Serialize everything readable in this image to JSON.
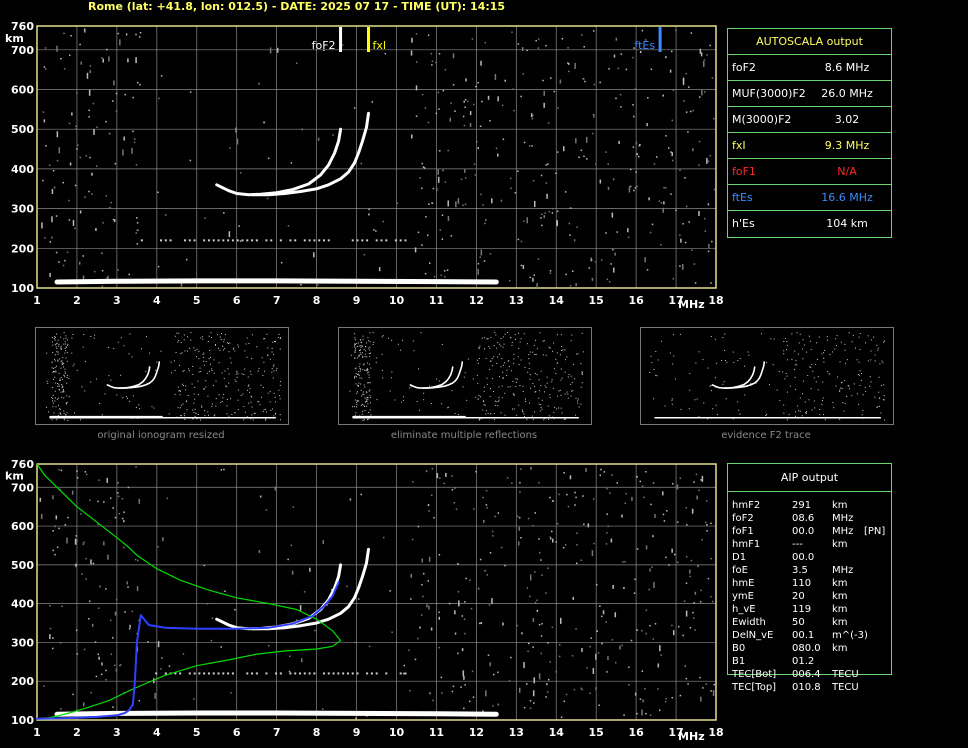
{
  "header": {
    "text": "Rome (lat: +41.8, lon: 012.5) - DATE: 2025 07 17 - TIME (UT): 14:15"
  },
  "colors": {
    "grid": "#8a8a8a",
    "frame": "#e6e08a",
    "panel_border": "#6cd76c",
    "title": "#ffff66",
    "fof2": "#ffffff",
    "fxi": "#ffff00",
    "fof1": "#ff2a2a",
    "ftes": "#3c8cff",
    "profile": "#00dd00",
    "trace_fit": "#3040ff"
  },
  "chart_data": [
    {
      "type": "scatter",
      "panel": "autoscala ionogram",
      "ylabel": "km",
      "xlabel": "MHz",
      "xlim": [
        1,
        18
      ],
      "ylim": [
        100,
        760
      ],
      "x_ticks": [
        "1",
        "2",
        "3",
        "4",
        "5",
        "6",
        "7",
        "8",
        "9",
        "10",
        "11",
        "12",
        "13",
        "14",
        "15",
        "16",
        "17",
        "18"
      ],
      "y_ticks": [
        "100",
        "200",
        "300",
        "400",
        "500",
        "600",
        "700",
        "760"
      ],
      "grid": true,
      "markers": [
        {
          "label": "foF2",
          "x": 8.6,
          "color": "#ffffff"
        },
        {
          "label": "fxI",
          "x": 9.3,
          "color": "#ffff00"
        },
        {
          "label": "ftEs",
          "x": 16.6,
          "color": "#3c8cff"
        }
      ],
      "traces": [
        {
          "name": "",
          "x": [
            5.5,
            5.8,
            6.0,
            6.3,
            6.6,
            7.0,
            7.4,
            7.8,
            8.1,
            8.3,
            8.45,
            8.55,
            8.6
          ],
          "y": [
            360,
            345,
            338,
            335,
            336,
            340,
            348,
            362,
            385,
            410,
            440,
            470,
            500
          ]
        },
        {
          "name": "",
          "x": [
            6.4,
            6.8,
            7.2,
            7.6,
            8.0,
            8.3,
            8.6,
            8.8,
            8.95,
            9.05,
            9.15,
            9.25,
            9.3
          ],
          "y": [
            335,
            335,
            338,
            343,
            350,
            360,
            375,
            392,
            415,
            440,
            470,
            505,
            540
          ]
        },
        {
          "name": "",
          "x": [
            1.5,
            3,
            5,
            7,
            9,
            11,
            12.5
          ],
          "y": [
            115,
            117,
            118,
            118,
            117,
            116,
            115
          ]
        }
      ]
    },
    {
      "type": "line",
      "panel": "AIP ionogram",
      "ylabel": "km",
      "xlabel": "MHz",
      "xlim": [
        1,
        18
      ],
      "ylim": [
        100,
        760
      ],
      "x_ticks": [
        "1",
        "2",
        "3",
        "4",
        "5",
        "6",
        "7",
        "8",
        "9",
        "10",
        "11",
        "12",
        "13",
        "14",
        "15",
        "16",
        "17",
        "18"
      ],
      "y_ticks": [
        "100",
        "200",
        "300",
        "400",
        "500",
        "600",
        "700",
        "760"
      ],
      "grid": true,
      "series": [
        {
          "name": "",
          "color": "#00dd00",
          "x": [
            1.0,
            1.2,
            1.6,
            2.0,
            2.5,
            3.0,
            3.3,
            3.5,
            4.0,
            4.6,
            5.3,
            6.0,
            6.8,
            7.5,
            8.0,
            8.4,
            8.6,
            8.4,
            8.0,
            7.2,
            6.5,
            5.8,
            5.0,
            4.2,
            3.4,
            2.8,
            2.2,
            1.8,
            1.5,
            1.3,
            1.1
          ],
          "y": [
            760,
            730,
            690,
            650,
            610,
            570,
            545,
            525,
            490,
            460,
            435,
            415,
            400,
            385,
            360,
            330,
            305,
            290,
            283,
            278,
            270,
            255,
            240,
            215,
            180,
            150,
            130,
            118,
            110,
            106,
            104
          ]
        },
        {
          "name": "",
          "color": "#3040ff",
          "x": [
            1.0,
            1.5,
            2.0,
            2.5,
            3.0,
            3.2,
            3.3,
            3.4,
            3.45,
            3.5,
            3.6,
            3.8,
            4.2,
            5.0,
            6.0,
            6.8,
            7.4,
            7.9,
            8.2,
            8.4,
            8.55
          ],
          "y": [
            103,
            104,
            106,
            108,
            112,
            118,
            125,
            140,
            200,
            300,
            370,
            345,
            338,
            335,
            335,
            338,
            348,
            368,
            395,
            420,
            455
          ]
        }
      ]
    }
  ],
  "autoscala": {
    "title": "AUTOSCALA output",
    "rows": [
      {
        "label": "foF2",
        "value": "8.6 MHz",
        "color": "#ffffff"
      },
      {
        "label": "MUF(3000)F2",
        "value": "26.0 MHz",
        "color": "#ffffff"
      },
      {
        "label": "M(3000)F2",
        "value": "3.02",
        "color": "#ffffff"
      },
      {
        "label": "fxI",
        "value": "9.3 MHz",
        "color": "#ffff66"
      },
      {
        "label": "foF1",
        "value": "N/A",
        "color": "#ff2a2a"
      },
      {
        "label": "ftEs",
        "value": "16.6 MHz",
        "color": "#3c8cff"
      },
      {
        "label": "h'Es",
        "value": "104    km",
        "color": "#ffffff"
      }
    ]
  },
  "thumbnails": [
    {
      "caption": "original ionogram resized"
    },
    {
      "caption": "eliminate multiple reflections"
    },
    {
      "caption": "evidence F2 trace"
    }
  ],
  "aip": {
    "title": "AIP output",
    "rows": [
      {
        "name": "hmF2",
        "value": "291",
        "unit": "km",
        "extra": ""
      },
      {
        "name": "foF2",
        "value": "08.6",
        "unit": "MHz",
        "extra": ""
      },
      {
        "name": "foF1",
        "value": "00.0",
        "unit": "MHz",
        "extra": "[PN]"
      },
      {
        "name": "hmF1",
        "value": "---",
        "unit": "km",
        "extra": ""
      },
      {
        "name": "D1",
        "value": "00.0",
        "unit": "",
        "extra": ""
      },
      {
        "name": "foE",
        "value": "3.5",
        "unit": "MHz",
        "extra": ""
      },
      {
        "name": "hmE",
        "value": "110",
        "unit": "km",
        "extra": ""
      },
      {
        "name": "ymE",
        "value": "20",
        "unit": "km",
        "extra": ""
      },
      {
        "name": "h_vE",
        "value": "119",
        "unit": "km",
        "extra": ""
      },
      {
        "name": "Ewidth",
        "value": "50",
        "unit": "km",
        "extra": ""
      },
      {
        "name": "DelN_vE",
        "value": "00.1",
        "unit": "m^(-3)",
        "extra": ""
      },
      {
        "name": "B0",
        "value": "080.0",
        "unit": "km",
        "extra": ""
      },
      {
        "name": "B1",
        "value": "01.2",
        "unit": "",
        "extra": ""
      },
      {
        "name": "TEC[Bot]",
        "value": "006.4",
        "unit": "TECU",
        "extra": ""
      },
      {
        "name": "TEC[Top]",
        "value": "010.8",
        "unit": "TECU",
        "extra": ""
      }
    ]
  }
}
